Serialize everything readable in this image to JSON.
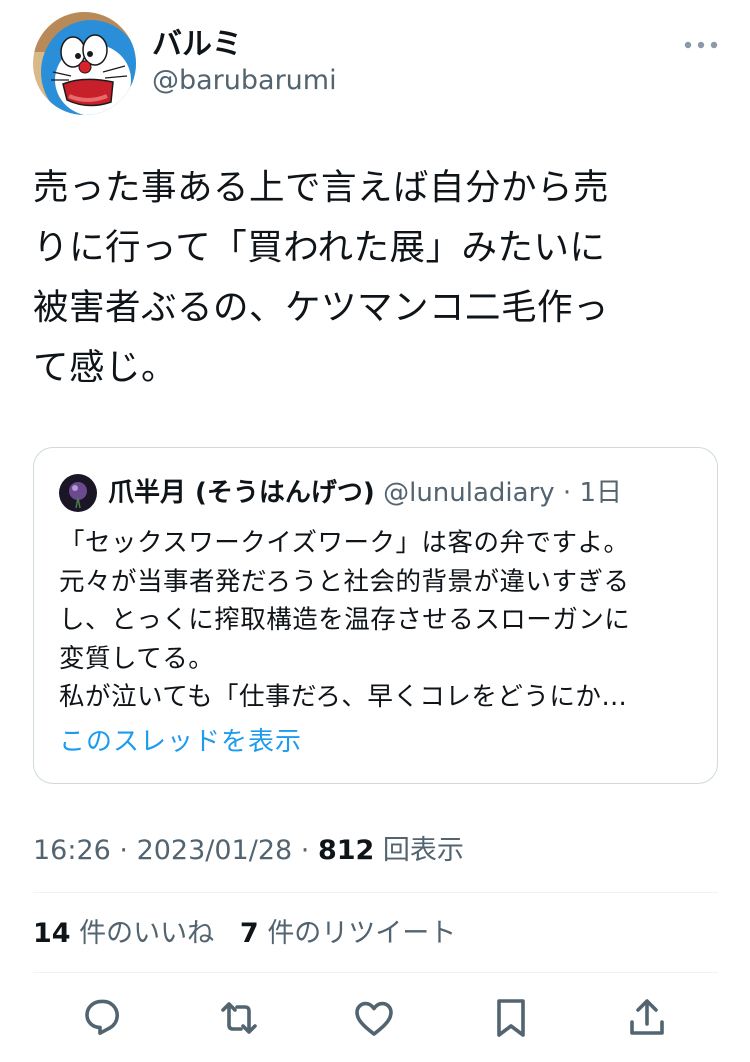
{
  "author": {
    "display_name": "バルミ",
    "handle": "@barubarumi"
  },
  "tweet": {
    "text": "売った事ある上で言えば自分から売\nりに行って「買われた展」みたいに\n被害者ぶるの、ケツマンコ二毛作っ\nて感じ。"
  },
  "quote": {
    "display_name": "爪半月 (そうはんげつ)",
    "handle": "@lunuladiary",
    "time": "1日",
    "text": "「セックスワークイズワーク」は客の弁ですよ。\n元々が当事者発だろうと社会的背景が違いすぎる\nし、とっくに搾取構造を温存させるスローガンに\n変質してる。\n私が泣いても「仕事だろ、早くコレをどうにか…",
    "show_thread": "このスレッドを表示"
  },
  "meta": {
    "time": "16:26",
    "date": "2023/01/28",
    "views": "812",
    "views_label": "回表示"
  },
  "stats": {
    "likes_count": "14",
    "likes_label": "件のいいね",
    "retweets_count": "7",
    "retweets_label": "件のリツイート"
  },
  "icons": [
    "more-icon",
    "reply-icon",
    "retweet-icon",
    "like-icon",
    "bookmark-icon",
    "share-icon"
  ],
  "colors": {
    "text": "#0f1419",
    "secondary": "#536471",
    "link": "#1d9bf0",
    "border": "#cfd9de"
  }
}
